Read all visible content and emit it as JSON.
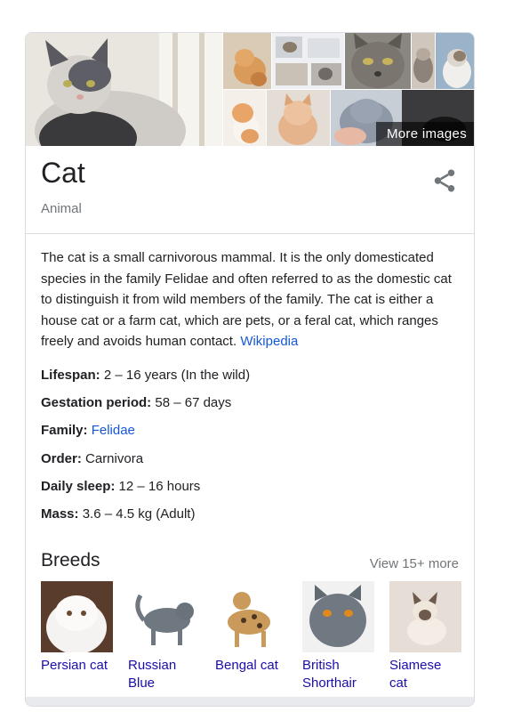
{
  "images": {
    "more_label": "More images"
  },
  "header": {
    "title": "Cat",
    "subtitle": "Animal",
    "share_icon": "share-icon"
  },
  "description": {
    "text": "The cat is a small carnivorous mammal. It is the only domesticated species in the family Felidae and often referred to as the domestic cat to distinguish it from wild members of the family. The cat is either a house cat or a farm cat, which are pets, or a feral cat, which ranges freely and avoids human contact.",
    "source": "Wikipedia"
  },
  "facts": [
    {
      "label": "Lifespan:",
      "value": "2 – 16 years (In the wild)",
      "is_link": false
    },
    {
      "label": "Gestation period:",
      "value": "58 – 67 days",
      "is_link": false
    },
    {
      "label": "Family:",
      "value": "Felidae",
      "is_link": true
    },
    {
      "label": "Order:",
      "value": "Carnivora",
      "is_link": false
    },
    {
      "label": "Daily sleep:",
      "value": "12 – 16 hours",
      "is_link": false
    },
    {
      "label": "Mass:",
      "value": "3.6 – 4.5 kg (Adult)",
      "is_link": false
    }
  ],
  "breeds": {
    "title": "Breeds",
    "view_more": "View 15+ more",
    "items": [
      {
        "line1": "Persian cat",
        "line2": ""
      },
      {
        "line1": "Russian",
        "line2": "Blue"
      },
      {
        "line1": "Bengal cat",
        "line2": ""
      },
      {
        "line1": "British",
        "line2": "Shorthair"
      },
      {
        "line1": "Siamese",
        "line2": "cat"
      }
    ]
  },
  "colors": {
    "link": "#1a0dab",
    "muted": "#70757a",
    "border": "#dadce0"
  }
}
